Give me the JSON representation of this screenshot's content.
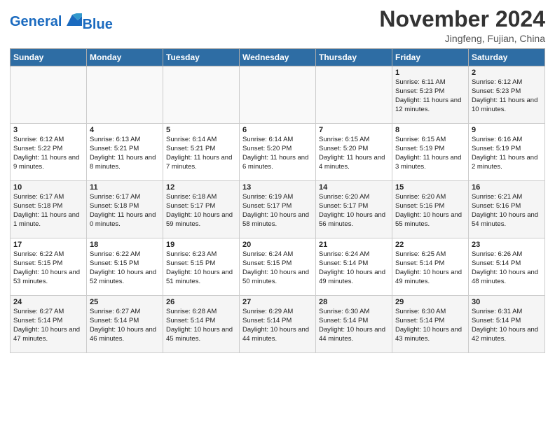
{
  "header": {
    "logo_general": "General",
    "logo_blue": "Blue",
    "month": "November 2024",
    "location": "Jingfeng, Fujian, China"
  },
  "days_of_week": [
    "Sunday",
    "Monday",
    "Tuesday",
    "Wednesday",
    "Thursday",
    "Friday",
    "Saturday"
  ],
  "weeks": [
    [
      {
        "day": "",
        "info": ""
      },
      {
        "day": "",
        "info": ""
      },
      {
        "day": "",
        "info": ""
      },
      {
        "day": "",
        "info": ""
      },
      {
        "day": "",
        "info": ""
      },
      {
        "day": "1",
        "info": "Sunrise: 6:11 AM\nSunset: 5:23 PM\nDaylight: 11 hours and 12 minutes."
      },
      {
        "day": "2",
        "info": "Sunrise: 6:12 AM\nSunset: 5:23 PM\nDaylight: 11 hours and 10 minutes."
      }
    ],
    [
      {
        "day": "3",
        "info": "Sunrise: 6:12 AM\nSunset: 5:22 PM\nDaylight: 11 hours and 9 minutes."
      },
      {
        "day": "4",
        "info": "Sunrise: 6:13 AM\nSunset: 5:21 PM\nDaylight: 11 hours and 8 minutes."
      },
      {
        "day": "5",
        "info": "Sunrise: 6:14 AM\nSunset: 5:21 PM\nDaylight: 11 hours and 7 minutes."
      },
      {
        "day": "6",
        "info": "Sunrise: 6:14 AM\nSunset: 5:20 PM\nDaylight: 11 hours and 6 minutes."
      },
      {
        "day": "7",
        "info": "Sunrise: 6:15 AM\nSunset: 5:20 PM\nDaylight: 11 hours and 4 minutes."
      },
      {
        "day": "8",
        "info": "Sunrise: 6:15 AM\nSunset: 5:19 PM\nDaylight: 11 hours and 3 minutes."
      },
      {
        "day": "9",
        "info": "Sunrise: 6:16 AM\nSunset: 5:19 PM\nDaylight: 11 hours and 2 minutes."
      }
    ],
    [
      {
        "day": "10",
        "info": "Sunrise: 6:17 AM\nSunset: 5:18 PM\nDaylight: 11 hours and 1 minute."
      },
      {
        "day": "11",
        "info": "Sunrise: 6:17 AM\nSunset: 5:18 PM\nDaylight: 11 hours and 0 minutes."
      },
      {
        "day": "12",
        "info": "Sunrise: 6:18 AM\nSunset: 5:17 PM\nDaylight: 10 hours and 59 minutes."
      },
      {
        "day": "13",
        "info": "Sunrise: 6:19 AM\nSunset: 5:17 PM\nDaylight: 10 hours and 58 minutes."
      },
      {
        "day": "14",
        "info": "Sunrise: 6:20 AM\nSunset: 5:17 PM\nDaylight: 10 hours and 56 minutes."
      },
      {
        "day": "15",
        "info": "Sunrise: 6:20 AM\nSunset: 5:16 PM\nDaylight: 10 hours and 55 minutes."
      },
      {
        "day": "16",
        "info": "Sunrise: 6:21 AM\nSunset: 5:16 PM\nDaylight: 10 hours and 54 minutes."
      }
    ],
    [
      {
        "day": "17",
        "info": "Sunrise: 6:22 AM\nSunset: 5:15 PM\nDaylight: 10 hours and 53 minutes."
      },
      {
        "day": "18",
        "info": "Sunrise: 6:22 AM\nSunset: 5:15 PM\nDaylight: 10 hours and 52 minutes."
      },
      {
        "day": "19",
        "info": "Sunrise: 6:23 AM\nSunset: 5:15 PM\nDaylight: 10 hours and 51 minutes."
      },
      {
        "day": "20",
        "info": "Sunrise: 6:24 AM\nSunset: 5:15 PM\nDaylight: 10 hours and 50 minutes."
      },
      {
        "day": "21",
        "info": "Sunrise: 6:24 AM\nSunset: 5:14 PM\nDaylight: 10 hours and 49 minutes."
      },
      {
        "day": "22",
        "info": "Sunrise: 6:25 AM\nSunset: 5:14 PM\nDaylight: 10 hours and 49 minutes."
      },
      {
        "day": "23",
        "info": "Sunrise: 6:26 AM\nSunset: 5:14 PM\nDaylight: 10 hours and 48 minutes."
      }
    ],
    [
      {
        "day": "24",
        "info": "Sunrise: 6:27 AM\nSunset: 5:14 PM\nDaylight: 10 hours and 47 minutes."
      },
      {
        "day": "25",
        "info": "Sunrise: 6:27 AM\nSunset: 5:14 PM\nDaylight: 10 hours and 46 minutes."
      },
      {
        "day": "26",
        "info": "Sunrise: 6:28 AM\nSunset: 5:14 PM\nDaylight: 10 hours and 45 minutes."
      },
      {
        "day": "27",
        "info": "Sunrise: 6:29 AM\nSunset: 5:14 PM\nDaylight: 10 hours and 44 minutes."
      },
      {
        "day": "28",
        "info": "Sunrise: 6:30 AM\nSunset: 5:14 PM\nDaylight: 10 hours and 44 minutes."
      },
      {
        "day": "29",
        "info": "Sunrise: 6:30 AM\nSunset: 5:14 PM\nDaylight: 10 hours and 43 minutes."
      },
      {
        "day": "30",
        "info": "Sunrise: 6:31 AM\nSunset: 5:14 PM\nDaylight: 10 hours and 42 minutes."
      }
    ]
  ]
}
